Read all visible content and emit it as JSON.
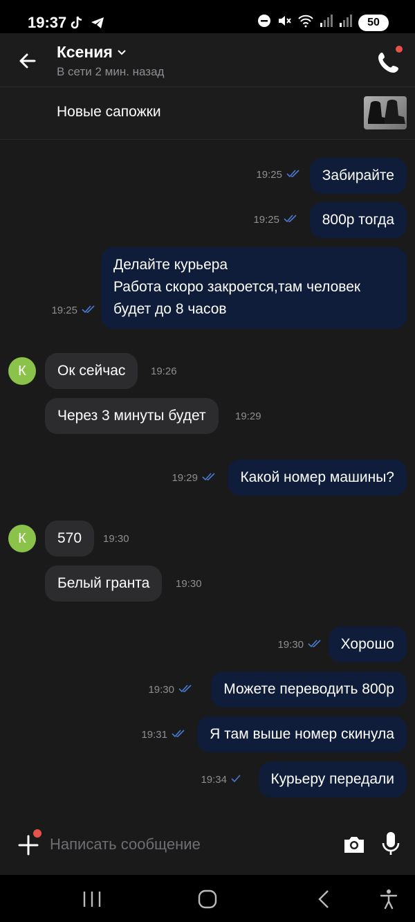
{
  "status_bar": {
    "time": "19:37",
    "battery": "50"
  },
  "header": {
    "contact_name": "Ксения",
    "contact_status": "В сети 2 мин. назад"
  },
  "item": {
    "title": "Новые сапожки"
  },
  "messages": [
    {
      "dir": "out",
      "text": "Забирайте",
      "time": "19:25",
      "read": true
    },
    {
      "dir": "out",
      "text": "800р тогда",
      "time": "19:25",
      "read": true
    },
    {
      "dir": "out",
      "text": "Делайте курьера\n Работа скоро закроется,там человек будет до 8 часов",
      "time": "19:25",
      "read": true
    },
    {
      "dir": "in",
      "text": "Ок сейчас",
      "time": "19:26",
      "avatar": "К"
    },
    {
      "dir": "in",
      "text": "Через 3 минуты будет",
      "time": "19:29"
    },
    {
      "dir": "out",
      "text": "Какой номер машины?",
      "time": "19:29",
      "read": true
    },
    {
      "dir": "in",
      "text": "570",
      "time": "19:30",
      "avatar": "К"
    },
    {
      "dir": "in",
      "text": "Белый гранта",
      "time": "19:30"
    },
    {
      "dir": "out",
      "text": "Хорошо",
      "time": "19:30",
      "read": true
    },
    {
      "dir": "out",
      "text": "Можете переводить 800р",
      "time": "19:30",
      "read": true
    },
    {
      "dir": "out",
      "text": "Я там выше номер скинула",
      "time": "19:31",
      "read": true
    },
    {
      "dir": "out",
      "text": "Курьеру передали",
      "time": "19:34",
      "read": false
    }
  ],
  "input": {
    "placeholder": "Написать сообщение"
  },
  "colors": {
    "outgoing_bubble": "#0f1d3a",
    "incoming_bubble": "#2c2c2e",
    "avatar": "#8bc34a",
    "notification_dot": "#e5534b",
    "check_read": "#4a7bd8"
  }
}
